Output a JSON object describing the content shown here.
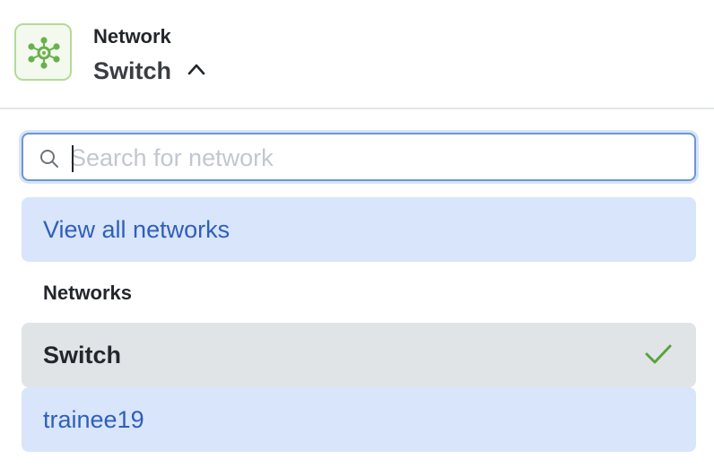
{
  "header": {
    "label": "Network",
    "value": "Switch",
    "icon": "network-hub-icon",
    "chevron_icon": "chevron-up-icon"
  },
  "search": {
    "placeholder": "Search for network",
    "value": "",
    "icon": "search-icon"
  },
  "view_all": {
    "label": "View all networks"
  },
  "networks": {
    "heading": "Networks",
    "items": [
      {
        "label": "Switch",
        "selected": true,
        "icon": "check-icon"
      },
      {
        "label": "trainee19",
        "selected": false
      }
    ]
  },
  "colors": {
    "accent_blue": "#2f5fbb",
    "highlight_blue": "#d9e5fb",
    "selected_gray": "#e1e4e7",
    "check_green": "#5aa33d",
    "logo_green": "#6ab04c"
  }
}
